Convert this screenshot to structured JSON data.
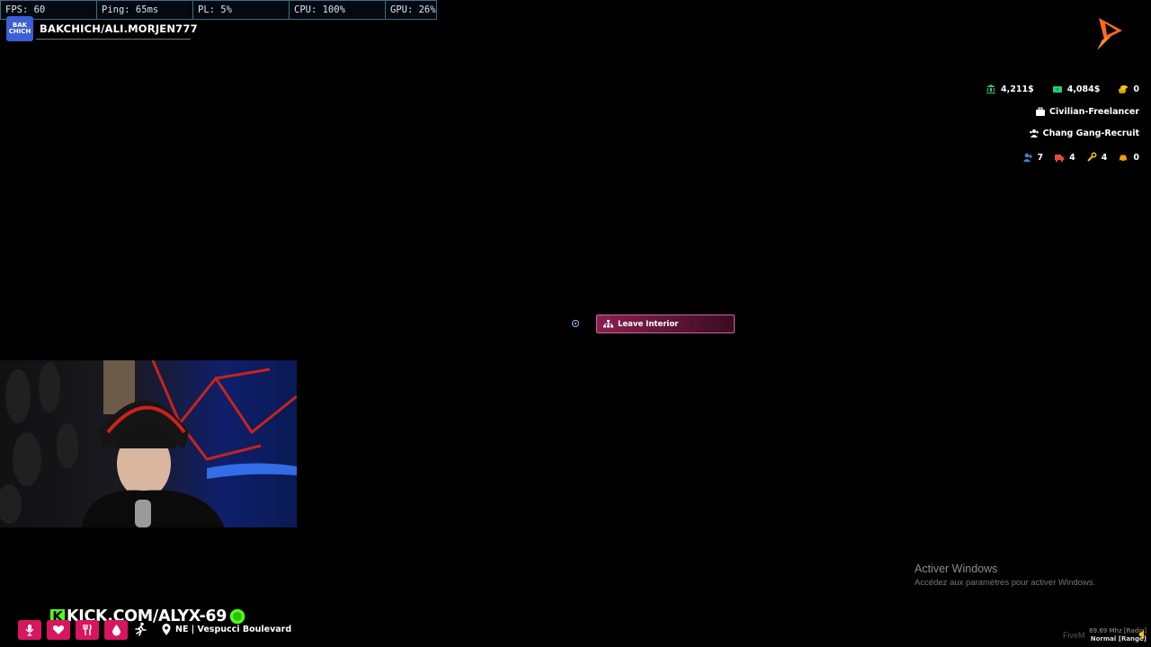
{
  "perf": {
    "fps": "FPS: 60",
    "ping": "Ping: 65ms",
    "pl": "PL: 5%",
    "cpu": "CPU: 100%",
    "gpu": "GPU: 26%"
  },
  "streamer": {
    "logo_top": "BAK",
    "logo_bottom": "CHICH",
    "name": "BAKCHICH/ALI.MORJEN777"
  },
  "hud": {
    "bank": "4,211$",
    "cash": "4,084$",
    "coins": "0",
    "job": "Civilian-Freelancer",
    "gang": "Chang Gang-Recruit",
    "counts": {
      "players": "7",
      "ems": "4",
      "mechanic": "4",
      "taxi": "0"
    },
    "colors": {
      "bank": "#2ecc71",
      "cash": "#2ecc71",
      "coins": "#f1c40f",
      "players": "#3b8ed8",
      "ems": "#e74c3c",
      "mechanic": "#f1c40f",
      "taxi": "#f39c12"
    },
    "icons": {
      "bank": "bank-icon",
      "cash": "cash-icon",
      "coins": "coins-icon",
      "job": "briefcase-icon",
      "gang": "users-icon",
      "players": "user-icon",
      "ems": "ambulance-icon",
      "mechanic": "wrench-icon",
      "taxi": "car-icon"
    }
  },
  "interaction": {
    "label": "Leave Interior",
    "icon": "sitemap-icon",
    "accent": "#8a1f52"
  },
  "windows": {
    "title": "Activer Windows",
    "subtitle": "Accédez aux paramètres pour activer Windows."
  },
  "radio": {
    "watermark": "FiveM",
    "frequency": "69.69 Mhz [Radio]",
    "mode": "Normal [Range]"
  },
  "kick": {
    "letter": "K",
    "url": "KICK.COM/ALYX-69",
    "brand_color": "#53fc18"
  },
  "status": {
    "icons": [
      "microphone-icon",
      "heart-icon",
      "food-icon",
      "water-icon",
      "running-icon",
      "map-pin-icon"
    ],
    "status_color": "#d6165f",
    "location": "NE | Vespucci Boulevard"
  }
}
